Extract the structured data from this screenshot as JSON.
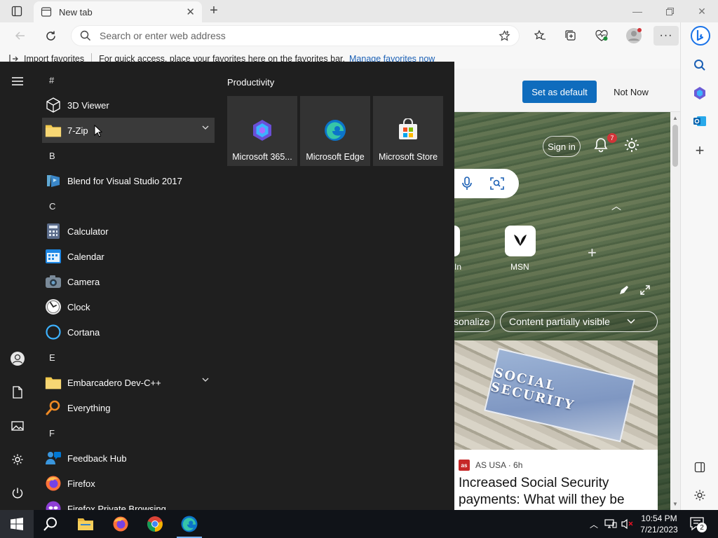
{
  "browser": {
    "tab_title": "New tab",
    "address_placeholder": "Search or enter web address",
    "favorites_bar": {
      "import_label": "Import favorites",
      "hint": "For quick access, place your favorites here on the favorites bar.",
      "manage_link": "Manage favorites now"
    }
  },
  "default_banner": {
    "set_default": "Set as default",
    "not_now": "Not Now"
  },
  "newtab": {
    "signin": "Sign in",
    "notification_count": "7",
    "quick_links": [
      {
        "label": "In"
      },
      {
        "label": "MSN"
      }
    ],
    "pills": {
      "personalize": "sonalize",
      "content": "Content partially visible"
    },
    "news_card": {
      "source_logo": "as",
      "source": "AS USA · 6h",
      "image_text": "SOCIAL SECURITY",
      "title": "Increased Social Security payments: What will they be"
    }
  },
  "start_menu": {
    "productivity_header": "Productivity",
    "tiles": [
      {
        "label": "Microsoft 365..."
      },
      {
        "label": "Microsoft Edge"
      },
      {
        "label": "Microsoft Store"
      }
    ],
    "groups": [
      {
        "letter": "#",
        "apps": [
          "3D Viewer",
          "7-Zip"
        ]
      },
      {
        "letter": "B",
        "apps": [
          "Blend for Visual Studio 2017"
        ]
      },
      {
        "letter": "C",
        "apps": [
          "Calculator",
          "Calendar",
          "Camera",
          "Clock",
          "Cortana"
        ]
      },
      {
        "letter": "E",
        "apps": [
          "Embarcadero Dev-C++",
          "Everything"
        ]
      },
      {
        "letter": "F",
        "apps": [
          "Feedback Hub",
          "Firefox",
          "Firefox Private Browsing"
        ]
      }
    ]
  },
  "taskbar": {
    "time": "10:54 PM",
    "date": "7/21/2023",
    "notification_count": "2"
  },
  "colors": {
    "accent_blue": "#0f6cbd",
    "start_bg": "#1f1f1f",
    "taskbar_bg": "#101318"
  }
}
